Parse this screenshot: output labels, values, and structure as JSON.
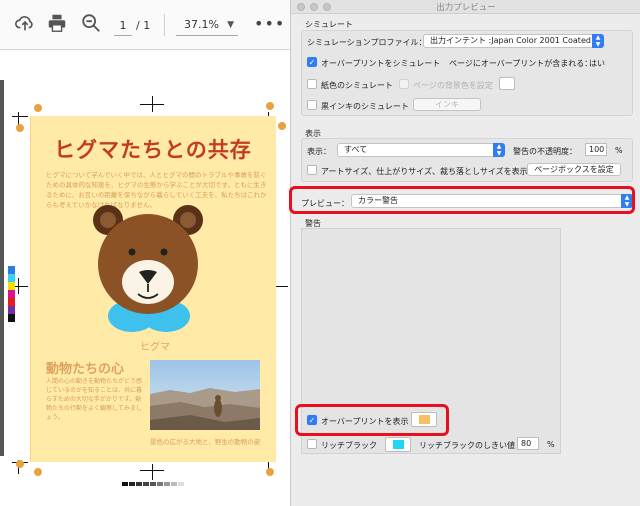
{
  "toolbar": {
    "page_current": "1",
    "page_total": "/ 1",
    "zoom": "37.1%",
    "more": "•••"
  },
  "document": {
    "title": "ヒグマたちとの共存",
    "paragraph": "ヒグマについて学んでいく中では、人とヒグマの間のトラブルや事故を防ぐための具体的な知恵を、ヒグマの生態から学ぶことが大切です。ともに生きるために、お互いの距離を保ちながら暮らしていく工夫を、私たちはこれからも考えていかなければなりません。",
    "bear_caption": "ヒグマ",
    "section_title": "動物たちの心",
    "section_paragraph": "人間の心の動きを動物たちがどう感じているのかを知ることは、共に暮らすための大切な手がかりです。動物たちの行動をよく観察してみましょう。",
    "photo_caption": "景色の広がる大地と、野生の動物の姿"
  },
  "panel": {
    "window_title": "出力プレビュー",
    "simulate_heading": "シミュレート",
    "profile_label": "シミュレーションプロファイル：",
    "profile_value": "出力インテント :Japan Color 2001 Coated",
    "overprint_sim_label": "オーバープリントをシミュレート",
    "page_overprint_label": "ページにオーバープリントが含まれる：",
    "page_overprint_value": "はい",
    "paper_sim_label": "紙色のシミュレート",
    "page_bg_label": "ページの背景色を設定",
    "black_ink_label": "黒インキのシミュレート",
    "ink_button": "インキ",
    "display_heading": "表示",
    "display_label": "表示：",
    "display_value": "すべて",
    "warn_opacity_label": "警告の不透明度：",
    "warn_opacity_value": "100",
    "percent": "%",
    "artsize_label": "アートサイズ、仕上がりサイズ、裁ち落としサイズを表示",
    "pagebox_button": "ページボックスを設定",
    "preview_label": "プレビュー：",
    "preview_value": "カラー警告",
    "warning_heading": "警告",
    "overprint_show_label": "オーバープリントを表示",
    "rich_black_label": "リッチブラック",
    "rich_black_threshold_label": "リッチブラックのしきい値",
    "rich_black_threshold_value": "80",
    "percent2": "%"
  },
  "colors": {
    "accent_blue": "#2f7cf6",
    "highlight_red": "#e8101e",
    "overprint_swatch": "#f5c164",
    "richblack_swatch": "#1fd7f5",
    "paper_yellow": "#ffeaa8"
  },
  "icons": [
    "upload-icon",
    "print-icon",
    "zoom-out-icon",
    "more-icon",
    "caret-down-icon"
  ]
}
